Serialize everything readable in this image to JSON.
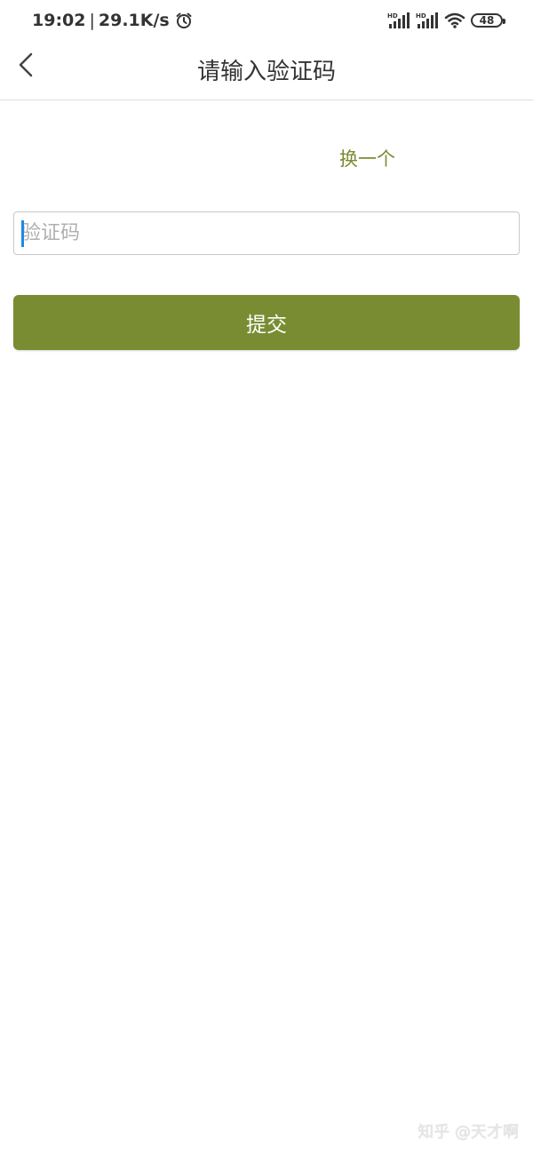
{
  "status_bar": {
    "time": "19:02",
    "separator": "|",
    "net_speed": "29.1K/s",
    "alarm_icon": "alarm-icon",
    "signal_1_label": "HD",
    "signal_2_label": "HD",
    "wifi_icon": "wifi-icon",
    "battery_level": "48"
  },
  "header": {
    "back_icon": "chevron-left-icon",
    "title": "请输入验证码"
  },
  "captcha": {
    "refresh_label": "换一个",
    "input_placeholder": "验证码",
    "input_value": "",
    "submit_label": "提交"
  },
  "watermark": {
    "text": "知乎 @天才啊"
  },
  "colors": {
    "accent": "#7a8c32",
    "caret": "#1e88e5"
  }
}
